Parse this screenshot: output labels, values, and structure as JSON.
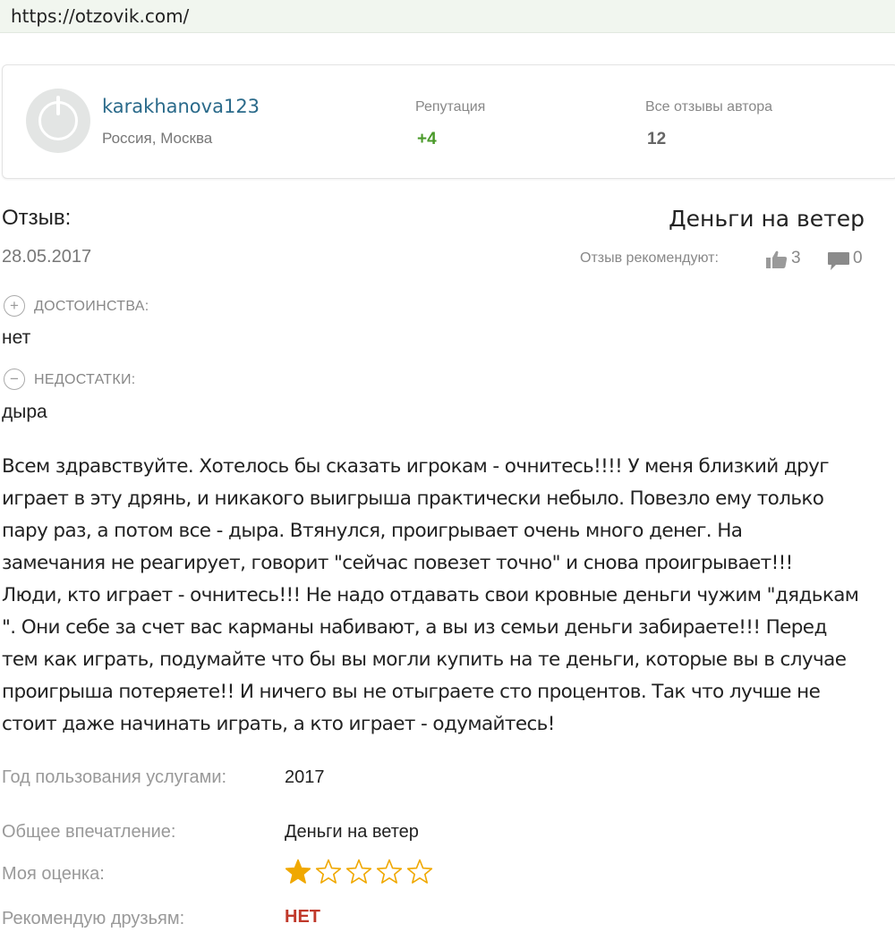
{
  "browser": {
    "url": "https://otzovik.com/"
  },
  "author": {
    "username": "karakhanova123",
    "location": "Россия, Москва",
    "reputation_label": "Репутация",
    "reputation_value": "+4",
    "all_reviews_label": "Все отзывы автора",
    "all_reviews_value": "12"
  },
  "review": {
    "heading": "Отзыв:",
    "title": "Деньги на ветер",
    "date": "28.05.2017",
    "recommend_label": "Отзыв рекомендуют:",
    "likes": "3",
    "comments": "0",
    "pros_label": "ДОСТОИНСТВА:",
    "pros_value": "нет",
    "cons_label": "НЕДОСТАТКИ:",
    "cons_value": "дыра",
    "body_lines": [
      "Всем здравствуйте. Хотелось бы сказать игрокам - очнитесь!!!! У меня близкий друг",
      "играет в эту дрянь, и никакого выигрыша практически небыло. Повезло ему только",
      "пару раз, а потом все - дыра. Втянулся, проигрывает очень много денег. На",
      "замечания не реагирует, говорит \"сейчас повезет точно\" и снова проигрывает!!!",
      "Люди, кто играет - очнитесь!!! Не надо отдавать свои кровные деньги чужим \"дядькам",
      "\". Они себе за счет вас карманы набивают, а вы из семьи деньги забираете!!! Перед",
      "тем как играть, подумайте что бы вы могли купить на те деньги, которые вы в случае",
      "проигрыша потеряете!! И ничего вы не отыграете сто процентов. Так что лучше не",
      "стоит даже начинать играть, а кто играет - одумайтесь!"
    ],
    "year_label": "Год пользования услугами:",
    "year_value": "2017",
    "impression_label": "Общее впечатление:",
    "impression_value": "Деньги на ветер",
    "rating_label": "Моя оценка:",
    "rating_value": 1,
    "rating_max": 5,
    "recommend_friends_label": "Рекомендую друзьям:",
    "recommend_friends_value": "НЕТ"
  },
  "colors": {
    "username": "#2a6a8a",
    "reputation": "#4a9a2a",
    "negative": "#c0392b",
    "star": "#f0a800"
  }
}
